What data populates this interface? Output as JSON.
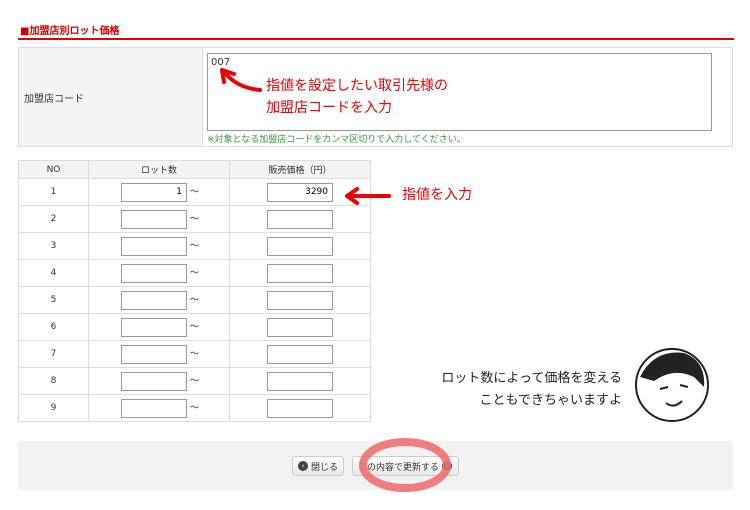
{
  "section_title": "■加盟店別ロット価格",
  "form": {
    "label": "加盟店コード",
    "value": "007",
    "hint": "※対象となる加盟店コードをカンマ区切りで入力してください。"
  },
  "annotations": {
    "code_line1": "指値を設定したい取引先様の",
    "code_line2": "加盟店コードを入力",
    "price": "指値を入力",
    "comment_line1": "ロット数によって価格を変える",
    "comment_line2": "こともできちゃいますよ"
  },
  "table": {
    "headers": [
      "NO",
      "ロット数",
      "販売価格（円）"
    ],
    "tilde": "～",
    "rows": [
      {
        "no": "1",
        "lot": "1",
        "price": "3290"
      },
      {
        "no": "2",
        "lot": "",
        "price": ""
      },
      {
        "no": "3",
        "lot": "",
        "price": ""
      },
      {
        "no": "4",
        "lot": "",
        "price": ""
      },
      {
        "no": "5",
        "lot": "",
        "price": ""
      },
      {
        "no": "6",
        "lot": "",
        "price": ""
      },
      {
        "no": "7",
        "lot": "",
        "price": ""
      },
      {
        "no": "8",
        "lot": "",
        "price": ""
      },
      {
        "no": "9",
        "lot": "",
        "price": ""
      }
    ]
  },
  "buttons": {
    "close": "閉じる",
    "update": "この内容で更新する"
  },
  "colors": {
    "accent": "#cc0000",
    "annotation": "#ee0000",
    "highlight_circle": "#f07070"
  }
}
